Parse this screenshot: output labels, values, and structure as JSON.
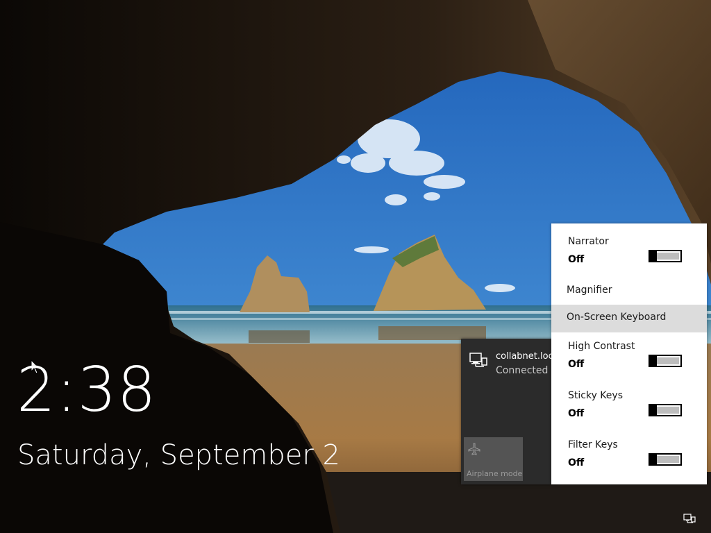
{
  "lock_screen": {
    "time": "2:38",
    "date": "Saturday, September 2"
  },
  "network_flyout": {
    "network_name": "collabnet.local",
    "network_status": "Connected",
    "network_icon": "ethernet-icon",
    "airplane_mode_label": "Airplane mode",
    "airplane_icon": "airplane-icon"
  },
  "ease_of_access": {
    "narrator": {
      "label": "Narrator",
      "state": "Off"
    },
    "magnifier": {
      "label": "Magnifier"
    },
    "on_screen_keyboard": {
      "label": "On-Screen Keyboard"
    },
    "high_contrast": {
      "label": "High Contrast",
      "state": "Off"
    },
    "sticky_keys": {
      "label": "Sticky Keys",
      "state": "Off"
    },
    "filter_keys": {
      "label": "Filter Keys",
      "state": "Off"
    }
  },
  "tray": {
    "network_icon": "ethernet-icon"
  },
  "colors": {
    "flyout_dark": "#2b2b2b",
    "flyout_light": "#ffffff",
    "highlight": "#dcdcdc",
    "toggle_off_fill": "#bdbdbd"
  }
}
